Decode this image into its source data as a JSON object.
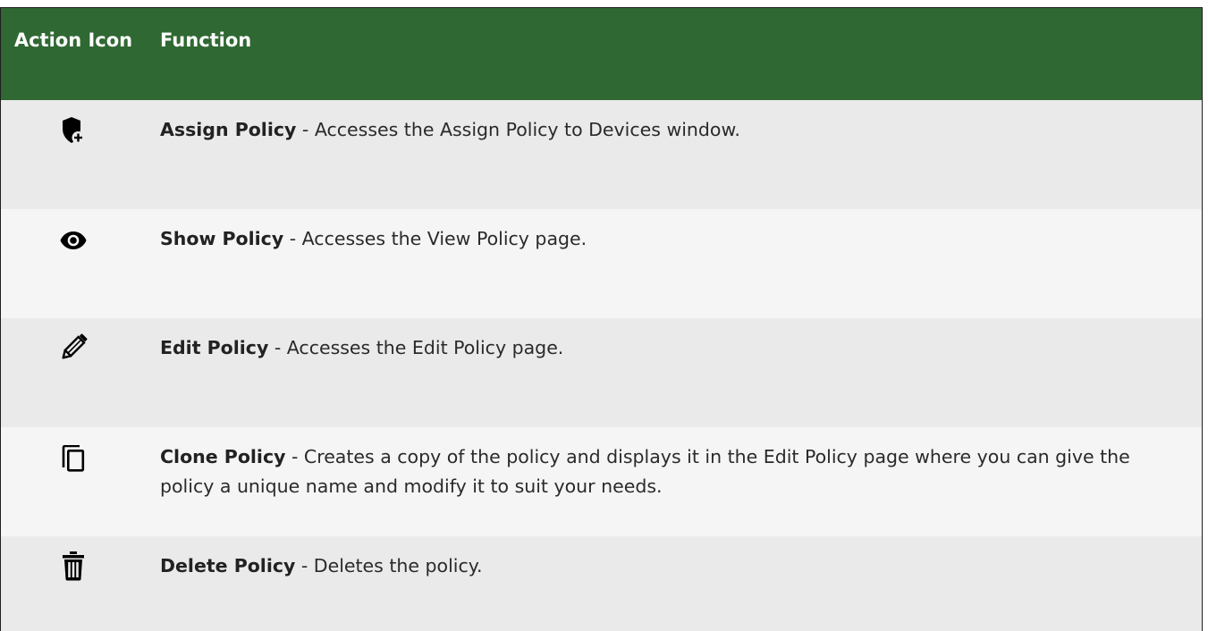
{
  "table": {
    "header": {
      "icon_col": "Action Icon",
      "function_col": "Function"
    },
    "rows": [
      {
        "icon": "shield-plus-icon",
        "name": "Assign Policy",
        "description": " - Accesses the Assign Policy to Devices window."
      },
      {
        "icon": "eye-icon",
        "name": "Show Policy",
        "description": " - Accesses the View Policy page."
      },
      {
        "icon": "pencil-icon",
        "name": "Edit Policy",
        "description": " - Accesses the Edit Policy page."
      },
      {
        "icon": "copy-icon",
        "name": "Clone Policy",
        "description": " - Creates a copy of the policy and displays it in the Edit Policy page where you can give the policy a unique name and modify it to suit your needs."
      },
      {
        "icon": "trash-icon",
        "name": "Delete Policy",
        "description": " - Deletes the policy."
      }
    ]
  },
  "colors": {
    "header_bg": "#306833",
    "row_odd_bg": "#eaeaea",
    "row_even_bg": "#f5f5f5"
  }
}
